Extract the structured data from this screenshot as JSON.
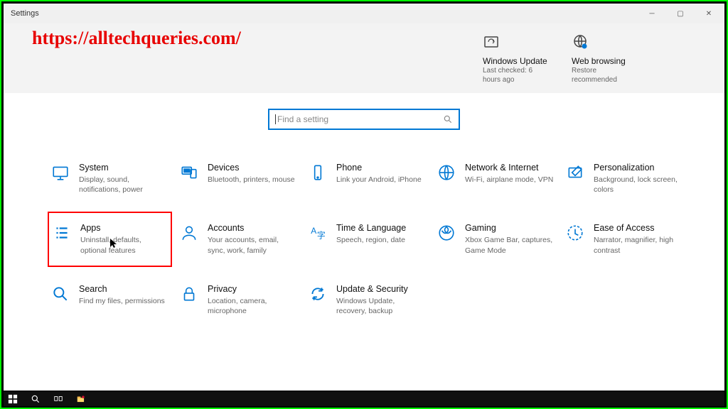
{
  "window": {
    "title": "Settings"
  },
  "watermark": "https://alltechqueries.com/",
  "header_tiles": [
    {
      "title": "Windows Update",
      "sub": "Last checked: 6 hours ago"
    },
    {
      "title": "Web browsing",
      "sub": "Restore recommended"
    }
  ],
  "search": {
    "placeholder": "Find a setting"
  },
  "categories": [
    {
      "id": "system",
      "title": "System",
      "desc": "Display, sound, notifications, power"
    },
    {
      "id": "devices",
      "title": "Devices",
      "desc": "Bluetooth, printers, mouse"
    },
    {
      "id": "phone",
      "title": "Phone",
      "desc": "Link your Android, iPhone"
    },
    {
      "id": "network",
      "title": "Network & Internet",
      "desc": "Wi-Fi, airplane mode, VPN"
    },
    {
      "id": "personalization",
      "title": "Personalization",
      "desc": "Background, lock screen, colors"
    },
    {
      "id": "apps",
      "title": "Apps",
      "desc": "Uninstall, defaults, optional features"
    },
    {
      "id": "accounts",
      "title": "Accounts",
      "desc": "Your accounts, email, sync, work, family"
    },
    {
      "id": "time",
      "title": "Time & Language",
      "desc": "Speech, region, date"
    },
    {
      "id": "gaming",
      "title": "Gaming",
      "desc": "Xbox Game Bar, captures, Game Mode"
    },
    {
      "id": "ease",
      "title": "Ease of Access",
      "desc": "Narrator, magnifier, high contrast"
    },
    {
      "id": "search",
      "title": "Search",
      "desc": "Find my files, permissions"
    },
    {
      "id": "privacy",
      "title": "Privacy",
      "desc": "Location, camera, microphone"
    },
    {
      "id": "update",
      "title": "Update & Security",
      "desc": "Windows Update, recovery, backup"
    }
  ]
}
